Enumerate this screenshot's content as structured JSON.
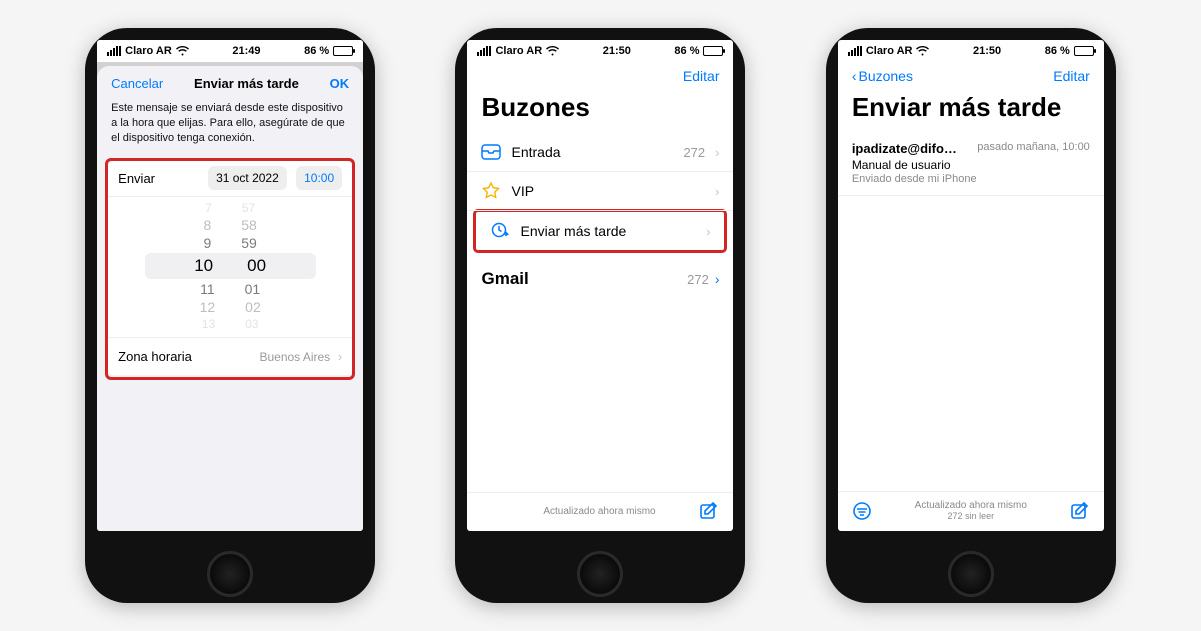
{
  "phone1": {
    "status": {
      "carrier": "Claro AR",
      "time": "21:49",
      "battery": "86 %"
    },
    "modal": {
      "cancel": "Cancelar",
      "title": "Enviar más tarde",
      "ok": "OK",
      "description": "Este mensaje se enviará desde este dispositivo a la hora que elijas. Para ello, asegúrate de que el dispositivo tenga conexión.",
      "send_label": "Enviar",
      "date_chip": "31 oct 2022",
      "time_chip": "10:00",
      "picker": {
        "r0h": "7",
        "r0m": "57",
        "r1h": "8",
        "r1m": "58",
        "r2h": "9",
        "r2m": "59",
        "r3h": "10",
        "r3m": "00",
        "r4h": "11",
        "r4m": "01",
        "r5h": "12",
        "r5m": "02",
        "r6h": "13",
        "r6m": "03"
      },
      "tz_label": "Zona horaria",
      "tz_value": "Buenos Aires"
    }
  },
  "phone2": {
    "status": {
      "carrier": "Claro AR",
      "time": "21:50",
      "battery": "86 %"
    },
    "edit": "Editar",
    "title": "Buzones",
    "inbox": {
      "label": "Entrada",
      "count": "272"
    },
    "vip": {
      "label": "VIP"
    },
    "sendlater": {
      "label": "Enviar más tarde"
    },
    "gmail": {
      "label": "Gmail",
      "count": "272"
    },
    "footer": "Actualizado ahora mismo"
  },
  "phone3": {
    "status": {
      "carrier": "Claro AR",
      "time": "21:50",
      "battery": "86 %"
    },
    "back": "Buzones",
    "edit": "Editar",
    "title": "Enviar más tarde",
    "msg": {
      "from": "ipadizate@difo…",
      "when": "pasado mañana, 10:00",
      "subject": "Manual de usuario",
      "preview": "Enviado desde mi iPhone"
    },
    "footer": "Actualizado ahora mismo",
    "footer_sub": "272 sin leer"
  }
}
